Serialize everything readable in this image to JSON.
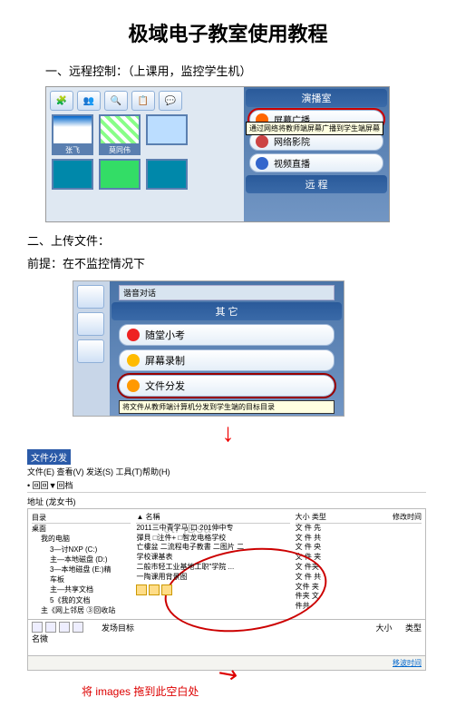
{
  "title": "极域电子教室使用教程",
  "section1": {
    "heading": "一、远程控制：（上课用，监控学生机）"
  },
  "shot1": {
    "thumbs": [
      "张飞",
      "莫同伟",
      ""
    ],
    "panel_header1": "演播室",
    "items": [
      "屏幕广播",
      "网络影院",
      "视频直播"
    ],
    "tooltip": "通过网络将教师端屏幕广播到学生端屏幕",
    "panel_header2": "远   程"
  },
  "section2": {
    "heading": "二、上传文件：",
    "premise": "前提：在不监控情况下"
  },
  "shot2": {
    "dialog_title": "谐音对话",
    "panel_header": "其   它",
    "items": [
      "随堂小考",
      "屏幕录制",
      "文件分发"
    ],
    "tooltip": "将文件从教师端计算机分发到学生端的目标目录"
  },
  "shot3": {
    "window_title": "文件分发",
    "menubar": "文件(E) 查看(V) 发送(S) 工具(T)帮助(H)",
    "toolbar_nav": "• 回回▼回档",
    "address_label": "地址",
    "address_value": "(龙女书)",
    "tree": {
      "header": "目录",
      "items": [
        {
          "t": "桌面",
          "i": 0
        },
        {
          "t": "我的电脑",
          "i": 1
        },
        {
          "t": "3—讨NXP (C:)",
          "i": 2
        },
        {
          "t": "主—本地磁盘 (D:)",
          "i": 2
        },
        {
          "t": "3—本地磁盘 (E:)精",
          "i": 2
        },
        {
          "t": "车板",
          "i": 2
        },
        {
          "t": "主—共享文档",
          "i": 2
        },
        {
          "t": "5《我的文档",
          "i": 2
        },
        {
          "t": "主《网上邻居 ③回收站",
          "i": 1
        }
      ]
    },
    "list": {
      "col_name": "名稱",
      "rows": [
        "2011三中青学马 口 201伸中专",
        "彈貝 □注件+ □智龙电格学校",
        "亡樓盆 二流程电子教書 二图片 二",
        "学校课基表",
        "二般市轻工业基地工职\"学院 ...",
        "一陶课用背景图"
      ]
    },
    "meta": {
      "col_size": "大小 类型",
      "col_time": "修改时间",
      "rows": [
        "文 件 先",
        "文 件 共",
        "文 件 央",
        "文 件 夹",
        "文 件夹",
        "文 件 共",
        "文件 夹",
        "件夹 文",
        "件共"
      ]
    },
    "bottom": {
      "col_name": "名微",
      "col_target": "发场目标",
      "col_size": "大小",
      "col_type": "类型",
      "status_link": "移波时间"
    },
    "watermark": "ctl jBsa"
  },
  "final_note": "将 images 拖到此空白处"
}
